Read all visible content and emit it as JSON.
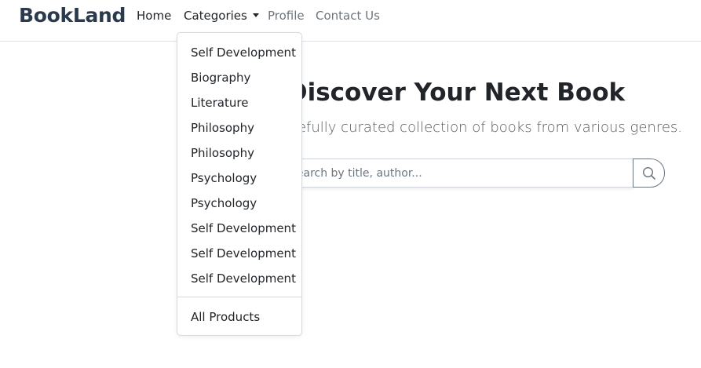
{
  "navbar": {
    "brand": "BookLand",
    "links": {
      "home": "Home",
      "categories": "Categories",
      "profile": "Profile",
      "contact": "Contact Us"
    }
  },
  "dropdown": {
    "items": [
      "Self Development",
      "Biography",
      "Literature",
      "Philosophy",
      "Philosophy",
      "Psychology",
      "Psychology",
      "Self Development",
      "Self Development",
      "Self Development"
    ],
    "footer_item": "All Products"
  },
  "hero": {
    "title": "Discover Your Next Book",
    "subtitle": "Explore our carefully curated collection of books from various genres.",
    "search": {
      "placeholder": "Search by title, author...",
      "button_icon": "search-icon"
    }
  },
  "colors": {
    "brand": "#2b3a4d",
    "text": "#212529",
    "muted": "#6c757d",
    "border": "#dee2e6"
  }
}
